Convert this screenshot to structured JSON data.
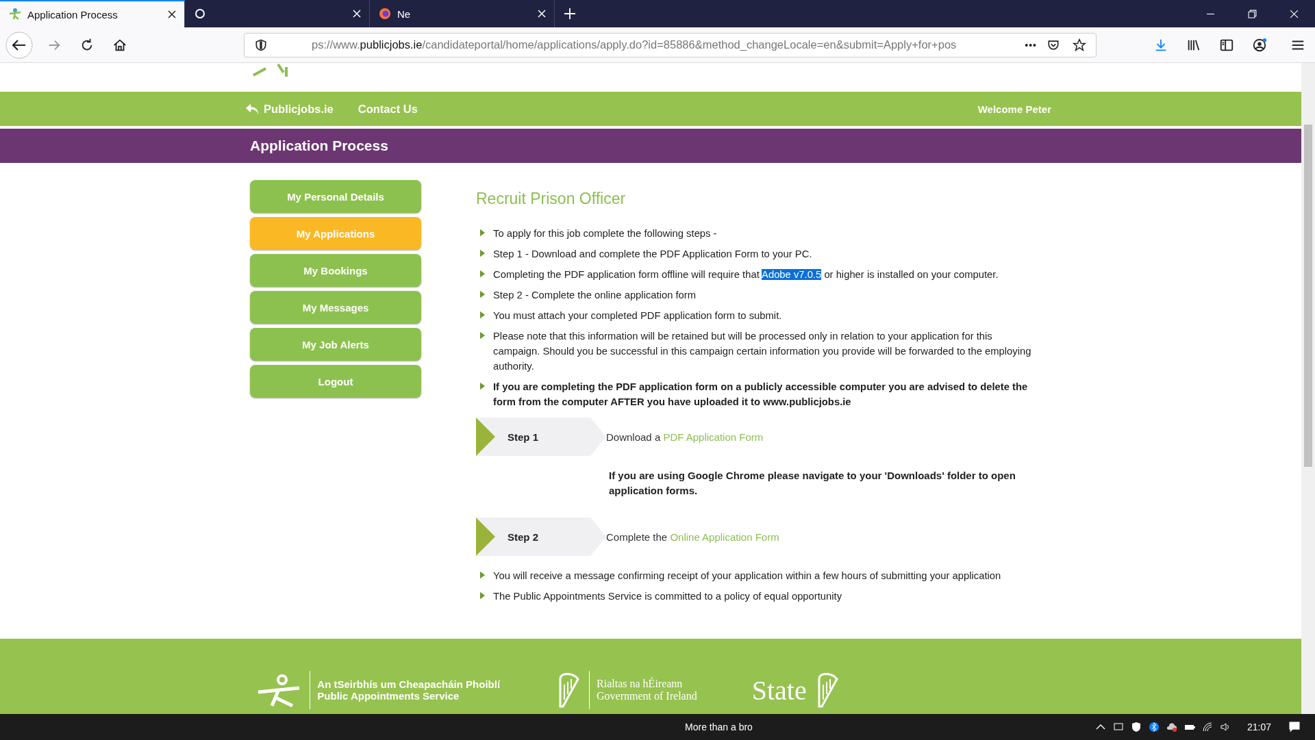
{
  "browser": {
    "tabs": [
      {
        "title": "Application Process",
        "selected": true
      },
      {
        "selected": false
      },
      {
        "title": "Ne",
        "selected": false
      }
    ],
    "url": {
      "prefix": "ps://www.",
      "domain": "publicjobs.ie",
      "path": "/candidateportal/home/applications/apply.do?id=85886&method_changeLocale=en&submit=Apply+for+pos"
    },
    "more": "•••"
  },
  "nav": {
    "home": "Publicjobs.ie",
    "contact": "Contact Us",
    "welcome": "Welcome Peter"
  },
  "banner": "Application Process",
  "sidebar": {
    "items": [
      {
        "label": "My Personal Details",
        "selected": false
      },
      {
        "label": "My Applications",
        "selected": true
      },
      {
        "label": "My Bookings",
        "selected": false
      },
      {
        "label": "My Messages",
        "selected": false
      },
      {
        "label": "My Job Alerts",
        "selected": false
      },
      {
        "label": "Logout",
        "selected": false
      }
    ]
  },
  "content": {
    "title": "Recruit Prison Officer",
    "bullets": [
      {
        "kind": "plain",
        "text": "To apply for this job complete the following steps -"
      },
      {
        "kind": "plain",
        "text": "Step 1 - Download and complete the PDF Application Form to your PC."
      },
      {
        "kind": "highlight",
        "text": "Completing the PDF application form offline will require that ",
        "highlighted_text": "Adobe v7.0.5",
        "text_after": " or higher is installed on your computer."
      },
      {
        "kind": "plain",
        "text": "Step 2 - Complete the online application form"
      },
      {
        "kind": "plain",
        "text": "You must attach your completed PDF application form to submit."
      },
      {
        "kind": "plain",
        "text": "Please note that this information will be retained but will be processed only in relation to your application for this campaign. Should you be successful in this campaign certain information you provide will be forwarded to the employing authority."
      },
      {
        "kind": "bold",
        "text": "If you are completing the PDF application form on a publicly accessible computer you are advised to delete the form from the computer AFTER you have uploaded it to www.publicjobs.ie"
      }
    ],
    "steps": [
      {
        "label": "Step 1",
        "text": "Download a ",
        "link": "PDF Application Form",
        "note": "If you are using Google Chrome please navigate to your 'Downloads' folder to open application forms."
      },
      {
        "label": "Step 2",
        "text": "Complete the ",
        "link": "Online Application Form"
      }
    ],
    "footer_bullets": [
      {
        "kind": "plain",
        "text": "You will receive a message confirming receipt of your application within a few hours of submitting your application"
      },
      {
        "kind": "plain",
        "text": "The Public Appointments Service is committed to a policy of equal opportunity"
      }
    ]
  },
  "footer": {
    "pas": [
      "An tSeirbhís um Cheapacháin Phoiblí",
      "Public Appointments Service"
    ],
    "gov": [
      "Rialtas na hÉireann",
      "Government of Ireland"
    ],
    "state": "State"
  },
  "taskbar": {
    "items": [
      "More than a bro"
    ],
    "time": "21:07"
  }
}
